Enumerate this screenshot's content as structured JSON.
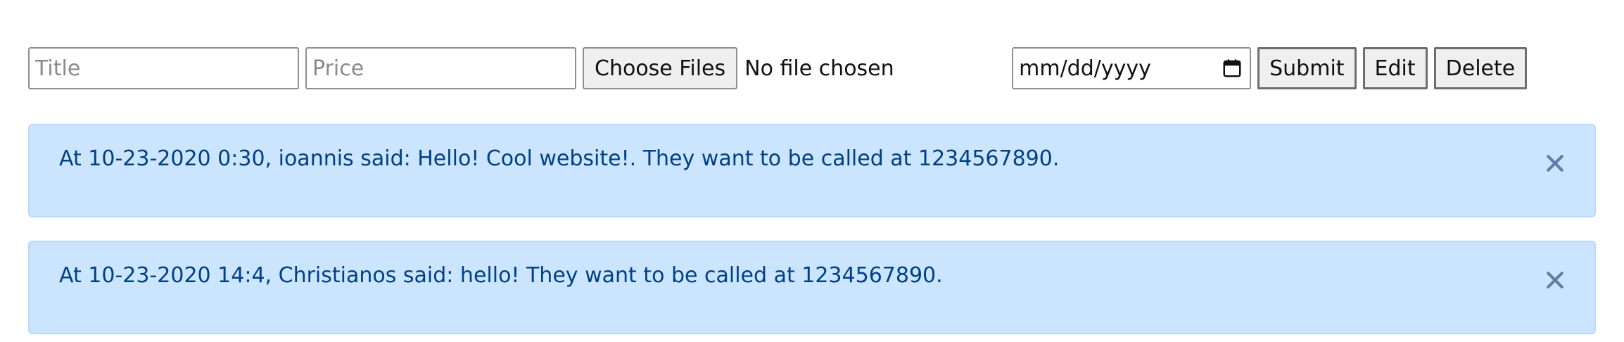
{
  "form": {
    "title_placeholder": "Title",
    "price_placeholder": "Price",
    "file_button_label": "Choose Files",
    "file_status": "No file chosen",
    "date_placeholder": "mm/dd/yyyy",
    "submit_label": "Submit",
    "edit_label": "Edit",
    "delete_label": "Delete"
  },
  "messages": [
    {
      "text": "At 10-23-2020 0:30, ioannis said: Hello! Cool website!. They want to be called at 1234567890.",
      "close_icon": "close-icon"
    },
    {
      "text": "At 10-23-2020 14:4, Christianos said: hello! They want to be called at 1234567890.",
      "close_icon": "close-icon"
    }
  ],
  "colors": {
    "alert_bg": "#cce5ff",
    "alert_border": "#b8daff",
    "alert_text": "#004085",
    "close_icon": "#5b7fa3"
  }
}
